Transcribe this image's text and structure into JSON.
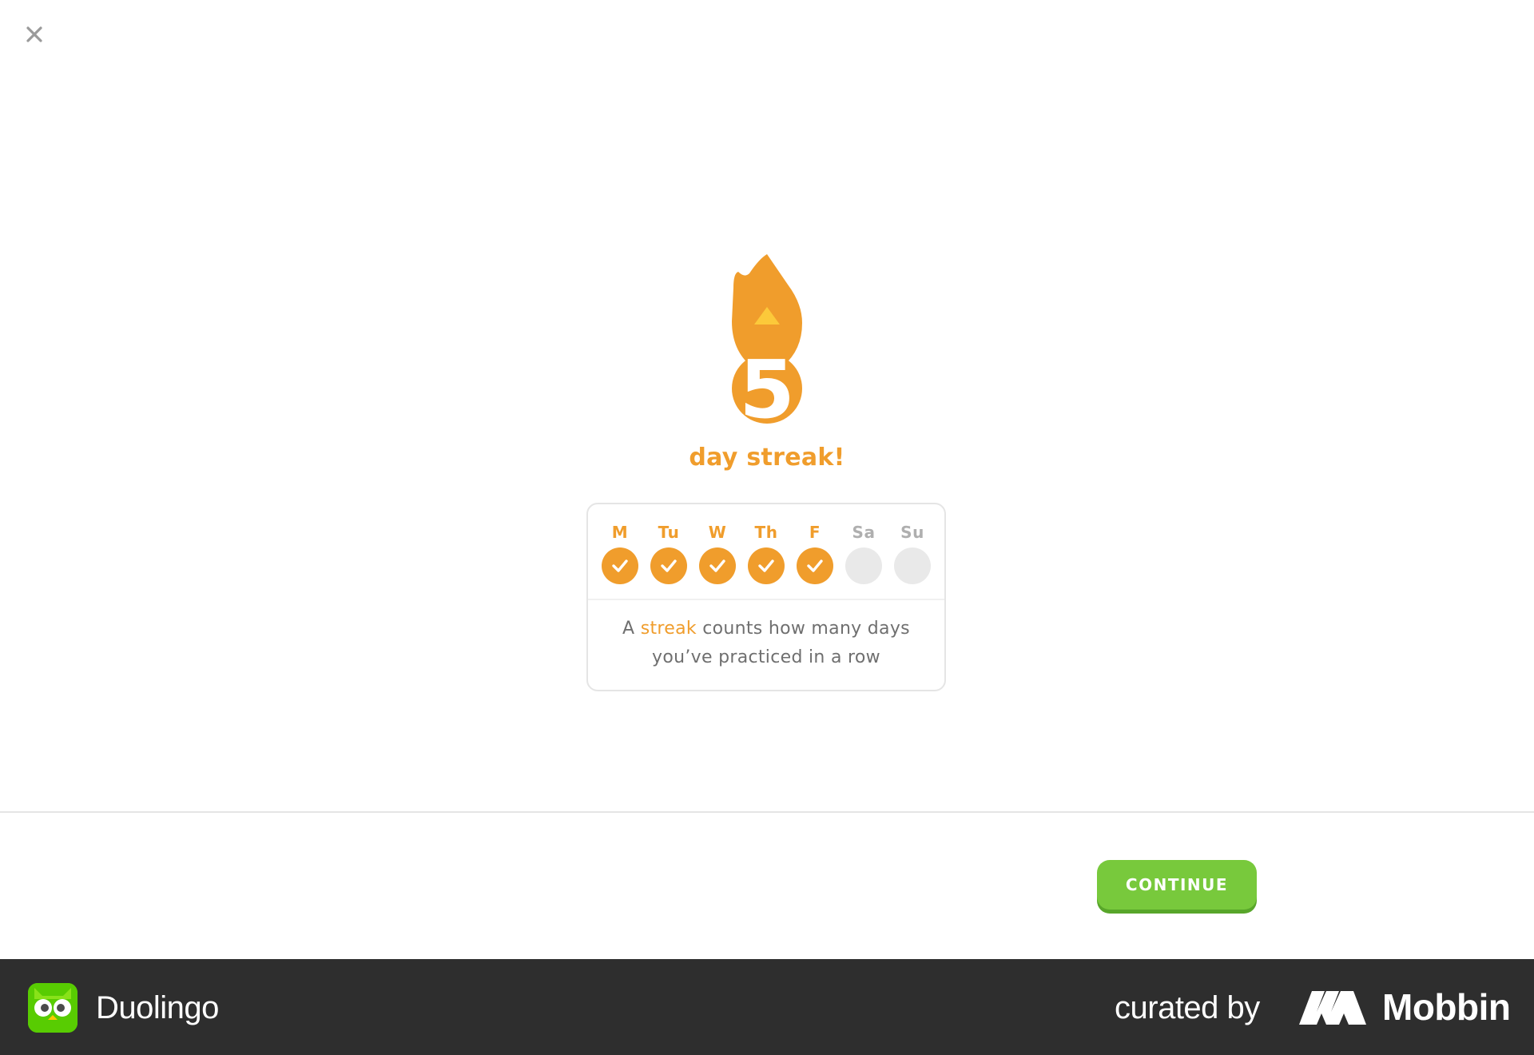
{
  "close_icon": "close-icon",
  "streak": {
    "count": "5",
    "label": "day streak!",
    "flame_color": "#f09d2c",
    "flame_tip_color": "#fcc93a"
  },
  "week": {
    "days": [
      {
        "label": "M",
        "done": true
      },
      {
        "label": "Tu",
        "done": true
      },
      {
        "label": "W",
        "done": true
      },
      {
        "label": "Th",
        "done": true
      },
      {
        "label": "F",
        "done": true
      },
      {
        "label": "Sa",
        "done": false
      },
      {
        "label": "Su",
        "done": false
      }
    ],
    "description": {
      "prefix": "A ",
      "highlight": "streak",
      "line1_rest": " counts how many days",
      "line2": "you’ve practiced in a row"
    }
  },
  "actions": {
    "continue_label": "CONTINUE",
    "continue_color": "#78c93c"
  },
  "footer": {
    "app_name": "Duolingo",
    "curated_by": "curated by",
    "brand": "Mobbin"
  }
}
